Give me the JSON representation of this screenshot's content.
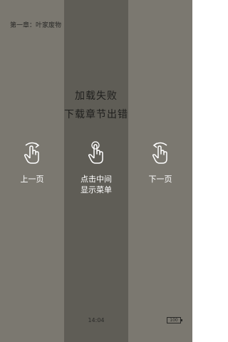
{
  "header": {
    "chapter_title": "第一章：叶家废物"
  },
  "error": {
    "line1": "加载失败",
    "line2": "下载章节出错"
  },
  "gestures": {
    "prev": {
      "label": "上一页",
      "icon": "swipe-right-hand-icon"
    },
    "menu": {
      "label": "点击中间\n显示菜单",
      "icon": "tap-hand-icon"
    },
    "next": {
      "label": "下一页",
      "icon": "swipe-left-hand-icon"
    }
  },
  "status": {
    "time": "14:04",
    "battery": "100"
  },
  "colors": {
    "side_zone": "#7b7870",
    "center_zone": "#5f5d56",
    "label": "#ffffff"
  }
}
